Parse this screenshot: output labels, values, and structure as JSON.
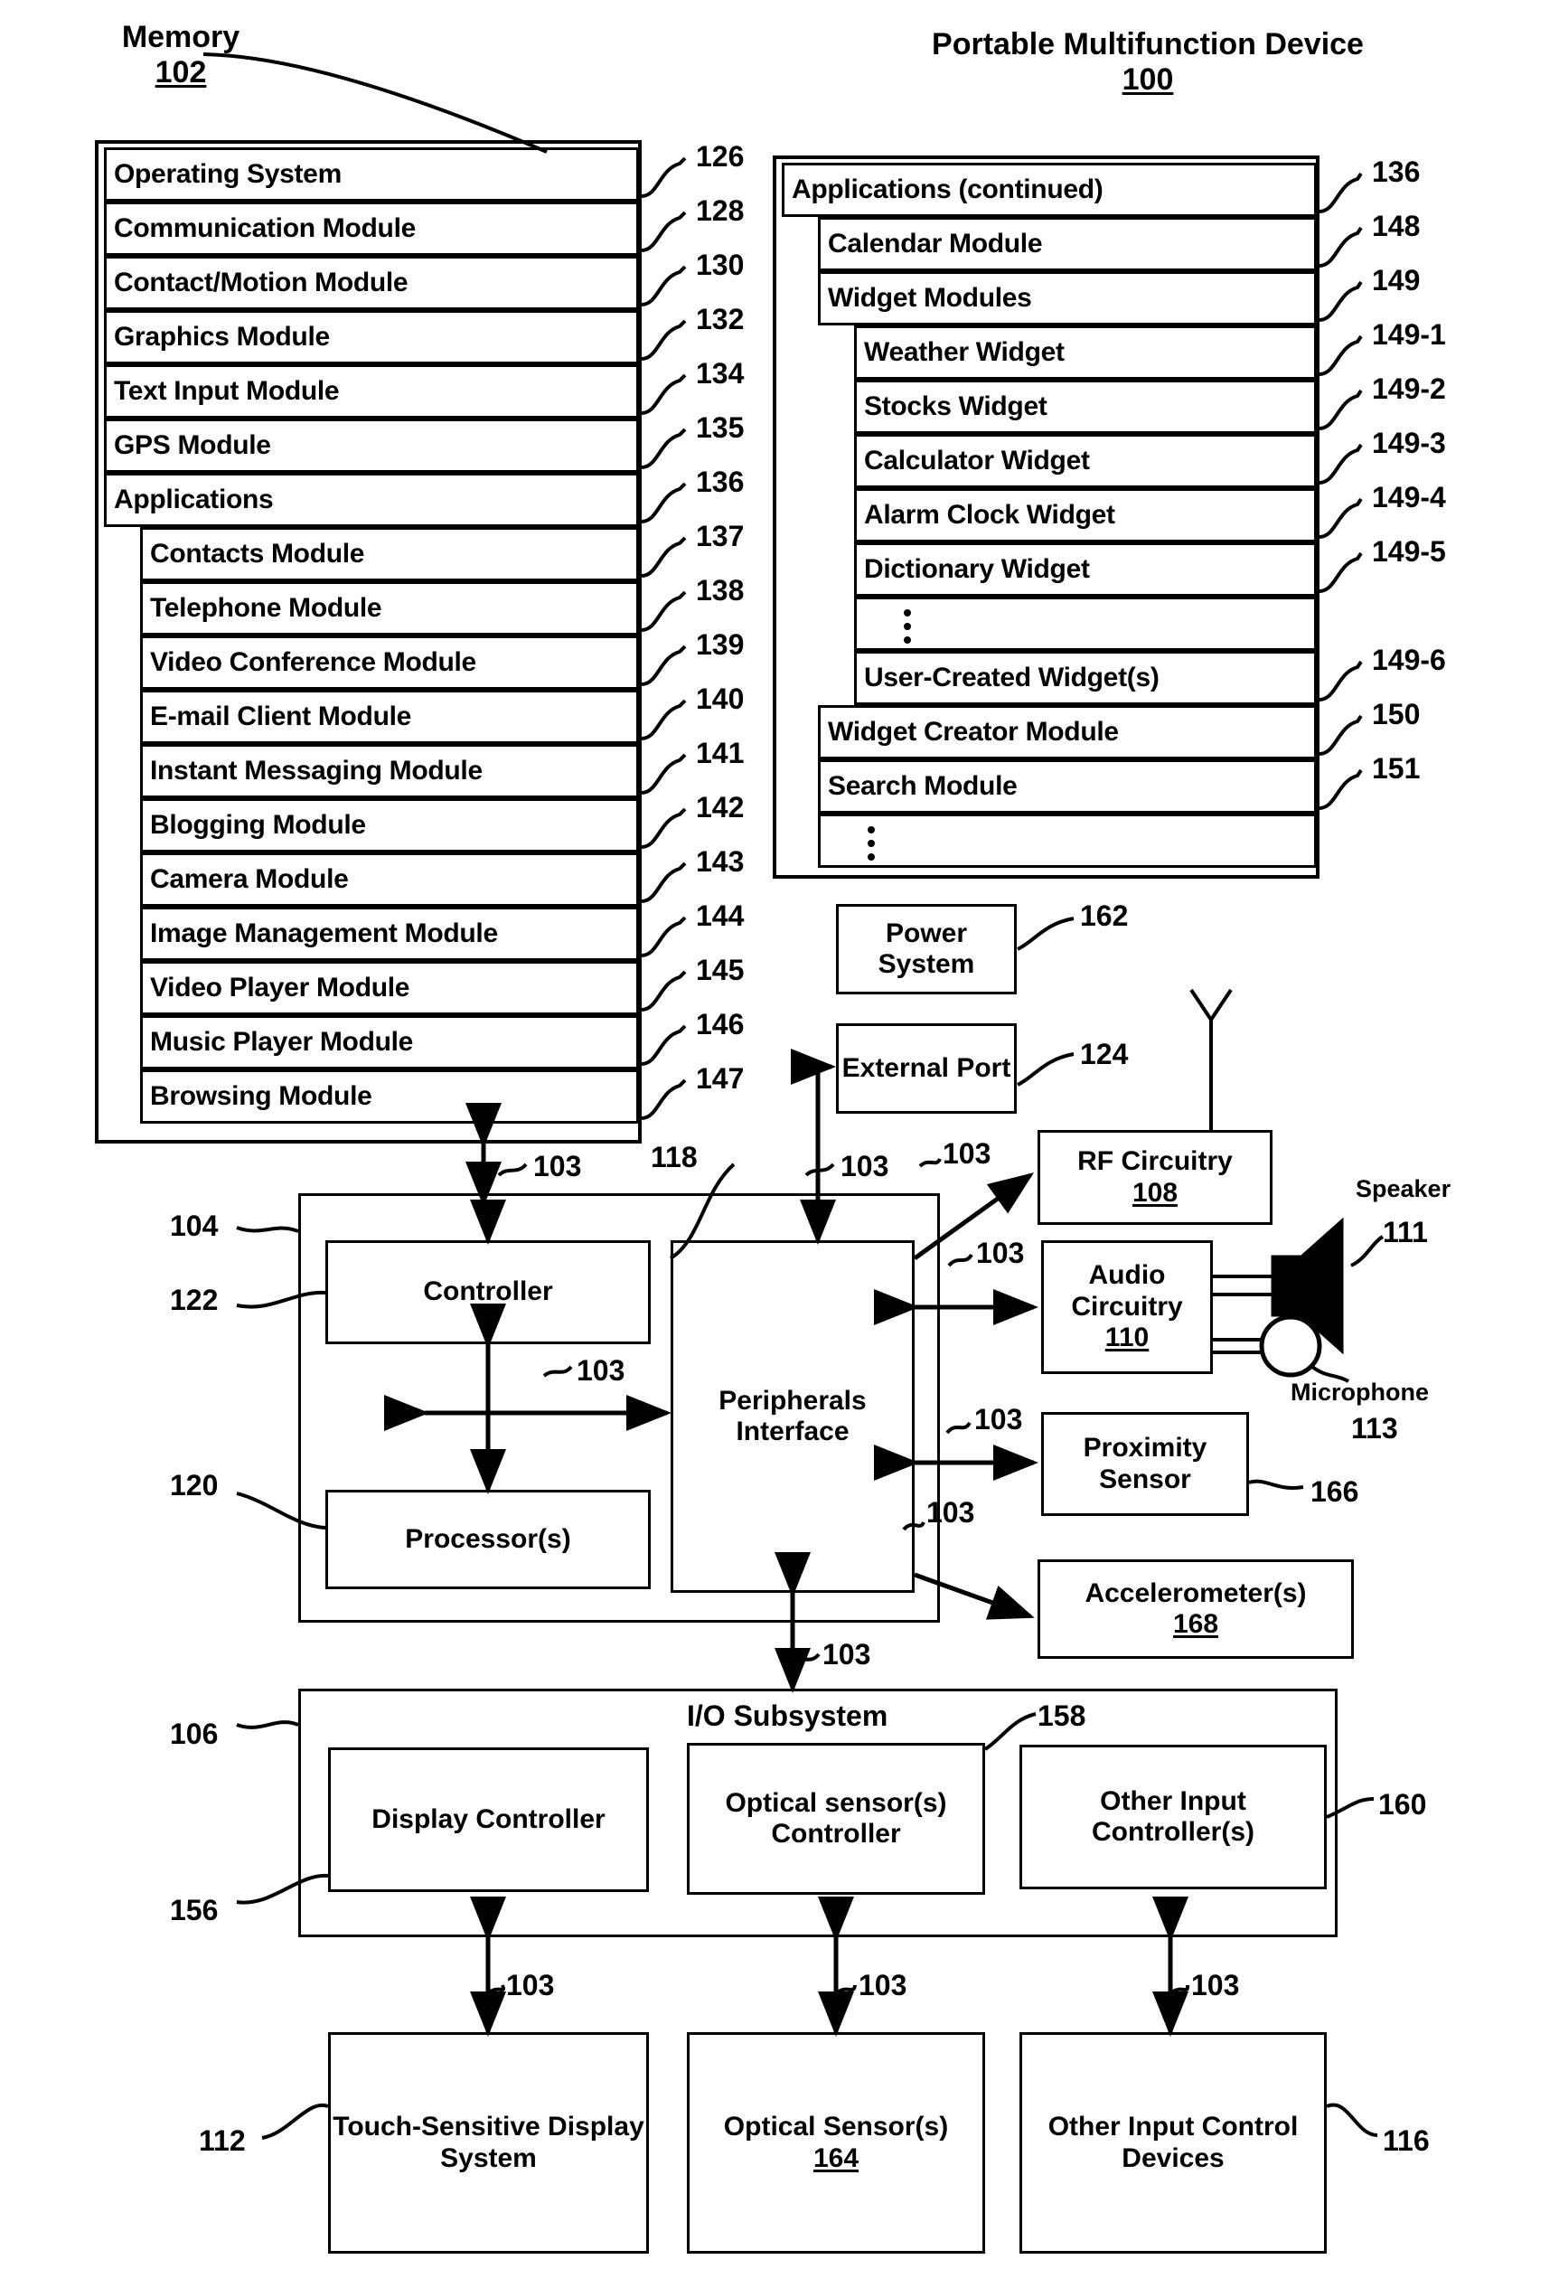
{
  "figure": {
    "memory_title": "Memory",
    "memory_ref": "102",
    "device_title": "Portable Multifunction Device",
    "device_ref": "100"
  },
  "memory_modules": [
    {
      "label": "Operating System",
      "ref": "126",
      "indent": 0
    },
    {
      "label": "Communication Module",
      "ref": "128",
      "indent": 0
    },
    {
      "label": "Contact/Motion Module",
      "ref": "130",
      "indent": 0
    },
    {
      "label": "Graphics Module",
      "ref": "132",
      "indent": 0
    },
    {
      "label": "Text Input Module",
      "ref": "134",
      "indent": 0
    },
    {
      "label": "GPS Module",
      "ref": "135",
      "indent": 0
    },
    {
      "label": "Applications",
      "ref": "136",
      "indent": 0
    },
    {
      "label": "Contacts Module",
      "ref": "137",
      "indent": 1
    },
    {
      "label": "Telephone Module",
      "ref": "138",
      "indent": 1
    },
    {
      "label": "Video Conference Module",
      "ref": "139",
      "indent": 1
    },
    {
      "label": "E-mail Client Module",
      "ref": "140",
      "indent": 1
    },
    {
      "label": "Instant Messaging Module",
      "ref": "141",
      "indent": 1
    },
    {
      "label": "Blogging Module",
      "ref": "142",
      "indent": 1
    },
    {
      "label": "Camera Module",
      "ref": "143",
      "indent": 1
    },
    {
      "label": "Image Management Module",
      "ref": "144",
      "indent": 1
    },
    {
      "label": "Video Player Module",
      "ref": "145",
      "indent": 1
    },
    {
      "label": "Music Player Module",
      "ref": "146",
      "indent": 1
    },
    {
      "label": "Browsing Module",
      "ref": "147",
      "indent": 1
    }
  ],
  "applications_continued": [
    {
      "label": "Applications (continued)",
      "ref": "136",
      "indent": 0
    },
    {
      "label": "Calendar Module",
      "ref": "148",
      "indent": 1
    },
    {
      "label": "Widget Modules",
      "ref": "149",
      "indent": 1
    },
    {
      "label": "Weather Widget",
      "ref": "149-1",
      "indent": 2
    },
    {
      "label": "Stocks Widget",
      "ref": "149-2",
      "indent": 2
    },
    {
      "label": "Calculator Widget",
      "ref": "149-3",
      "indent": 2
    },
    {
      "label": "Alarm Clock Widget",
      "ref": "149-4",
      "indent": 2
    },
    {
      "label": "Dictionary Widget",
      "ref": "149-5",
      "indent": 2
    },
    {
      "label": "",
      "ref": "",
      "indent": 2,
      "dots": true
    },
    {
      "label": "User-Created Widget(s)",
      "ref": "149-6",
      "indent": 2
    },
    {
      "label": "Widget Creator Module",
      "ref": "150",
      "indent": 1
    },
    {
      "label": "Search Module",
      "ref": "151",
      "indent": 1
    },
    {
      "label": "",
      "ref": "",
      "indent": 1,
      "dots": true
    }
  ],
  "blocks": {
    "power_system": {
      "label": "Power System",
      "ref": "162"
    },
    "external_port": {
      "label": "External Port",
      "ref": "124"
    },
    "rf_circuitry": {
      "label": "RF Circuitry",
      "ref": "108"
    },
    "audio_circuitry": {
      "label": "Audio Circuitry",
      "ref": "110"
    },
    "speaker": {
      "label": "Speaker",
      "ref": "111"
    },
    "microphone": {
      "label": "Microphone",
      "ref": "113"
    },
    "proximity_sensor": {
      "label": "Proximity Sensor",
      "ref": "166"
    },
    "accelerometers": {
      "label": "Accelerometer(s)",
      "ref": "168"
    },
    "controller": {
      "label": "Controller",
      "ref": "122"
    },
    "processors": {
      "label": "Processor(s)",
      "ref": "120"
    },
    "peripherals_interface": {
      "label": "Peripherals Interface",
      "ref": "118"
    },
    "cpu_group": {
      "ref": "104"
    },
    "io_subsystem": {
      "label": "I/O Subsystem",
      "ref": "106"
    },
    "display_controller": {
      "label": "Display Controller",
      "ref": "156"
    },
    "optical_sensor_controller": {
      "label": "Optical sensor(s) Controller",
      "ref": "158"
    },
    "other_input_controller": {
      "label": "Other Input Controller(s)",
      "ref": "160"
    },
    "touch_display": {
      "label": "Touch-Sensitive Display System",
      "ref": "112"
    },
    "optical_sensors": {
      "label": "Optical Sensor(s)",
      "ref": "164"
    },
    "other_input_devices": {
      "label": "Other Input Control Devices",
      "ref": "116"
    },
    "bus_ref": "103"
  },
  "bus_labels": [
    "103",
    "103",
    "103",
    "103",
    "103",
    "103",
    "103",
    "103",
    "103",
    "103",
    "103",
    "103"
  ],
  "colors": {
    "ink": "#000000",
    "paper": "#ffffff"
  }
}
